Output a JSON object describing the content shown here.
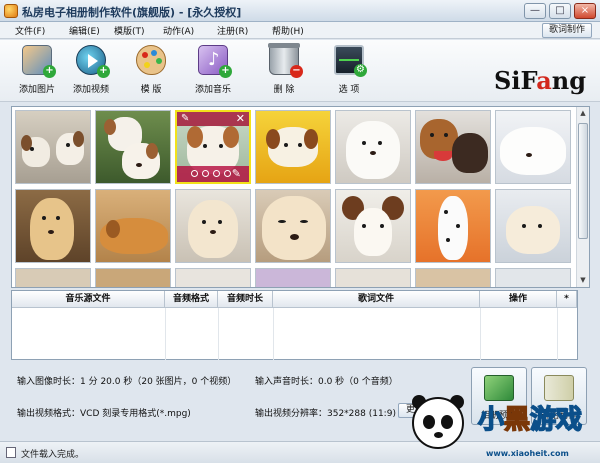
{
  "window": {
    "title": "私房电子相册制作软件(旗舰版) - [永久授权]",
    "controls": [
      "—",
      "□",
      "×"
    ]
  },
  "menubar": {
    "items": [
      "文件(F)",
      "编辑(E)",
      "模版(T)",
      "动作(A)",
      "注册(R)",
      "帮助(H)"
    ],
    "lyrics_button": "歌词制作"
  },
  "toolbar": {
    "tools": [
      {
        "label": "添加图片",
        "icon": "add-image-icon"
      },
      {
        "label": "添加视频",
        "icon": "add-video-icon"
      },
      {
        "label": "模 版",
        "icon": "palette-icon"
      },
      {
        "label": "添加音乐",
        "icon": "add-music-icon"
      },
      {
        "label": "删 除",
        "icon": "trash-icon"
      },
      {
        "label": "选 项",
        "icon": "options-icon"
      }
    ],
    "logo_a": "SiF",
    "logo_b": "a",
    "logo_c": "ng"
  },
  "colors": {
    "accent": "#d2271c",
    "selection": "#f2e21b",
    "watermark_blue": "#19a6e6",
    "watermark_orange": "#f07a16"
  },
  "music_table": {
    "columns": [
      "音乐源文件",
      "音频格式",
      "音频时长",
      "歌词文件",
      "操作",
      "*"
    ],
    "rows": []
  },
  "info": {
    "image_duration": "输入图像时长：1 分 20.0 秒（20 张图片，0 个视频）",
    "audio_duration": "输入声音时长：0.0 秒（0 个音频）",
    "video_format": "输出视频格式：VCD 刻录专用格式(*.mpg)",
    "video_resolution": "输出视频分辨率：352*288 (11:9)",
    "change_button": "更改"
  },
  "action_buttons": [
    {
      "label": "相册预览",
      "icon": "photo-preview-icon"
    },
    {
      "label": "开始制作",
      "icon": "zip-make-icon"
    }
  ],
  "status": {
    "text": "文件载入完成。"
  },
  "watermark": {
    "text_a": "小",
    "text_b": "黑",
    "text_c": "游戏",
    "url": "www.xiaoheit.com"
  }
}
